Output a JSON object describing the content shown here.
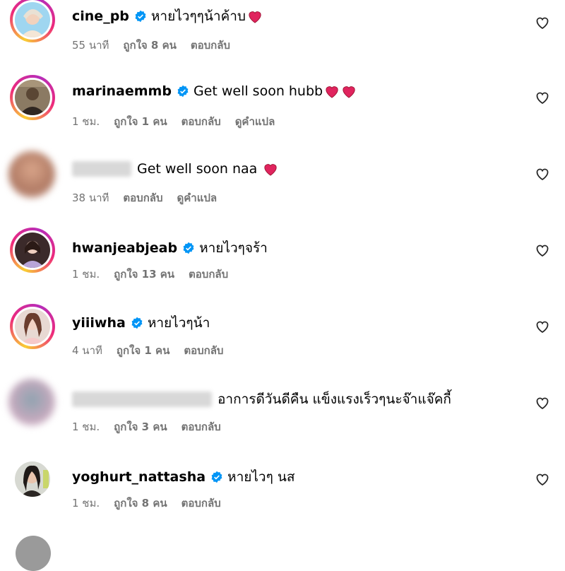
{
  "comments": [
    {
      "username": "cine_pb",
      "verified": true,
      "text": "หายไวๆๆน้าค้าบ",
      "hearts": 1,
      "time": "55 นาที",
      "likes": "ถูกใจ 8 คน",
      "reply": "ตอบกลับ",
      "translate": ""
    },
    {
      "username": "marinaemmb",
      "verified": true,
      "text": "Get well soon hubb",
      "hearts": 2,
      "time": "1 ชม.",
      "likes": "ถูกใจ 1 คน",
      "reply": "ตอบกลับ",
      "translate": "ดูคำแปล"
    },
    {
      "username": "",
      "verified": false,
      "text": "Get well soon naa",
      "hearts": 1,
      "time": "38 นาที",
      "likes": "",
      "reply": "ตอบกลับ",
      "translate": "ดูคำแปล"
    },
    {
      "username": "hwanjeabjeab",
      "verified": true,
      "text": "หายไวๆจร้า",
      "hearts": 0,
      "time": "1 ชม.",
      "likes": "ถูกใจ 13 คน",
      "reply": "ตอบกลับ",
      "translate": ""
    },
    {
      "username": "yiiiwha",
      "verified": true,
      "text": "หายไวๆน้า",
      "hearts": 0,
      "time": "4 นาที",
      "likes": "ถูกใจ 1 คน",
      "reply": "ตอบกลับ",
      "translate": ""
    },
    {
      "username": "",
      "verified": false,
      "text": "อาการดีวันดีคืน แข็งแรงเร็วๆนะจ๊าแจ๊คกี้",
      "hearts": 0,
      "time": "1 ชม.",
      "likes": "ถูกใจ 3 คน",
      "reply": "ตอบกลับ",
      "translate": ""
    },
    {
      "username": "yoghurt_nattasha",
      "verified": true,
      "text": "หายไวๆ นส",
      "hearts": 0,
      "time": "1 ชม.",
      "likes": "ถูกใจ 8 คน",
      "reply": "ตอบกลับ",
      "translate": ""
    }
  ],
  "colors": {
    "accent": "#0095f6",
    "muted": "#737373",
    "heart": "#e0245e"
  }
}
